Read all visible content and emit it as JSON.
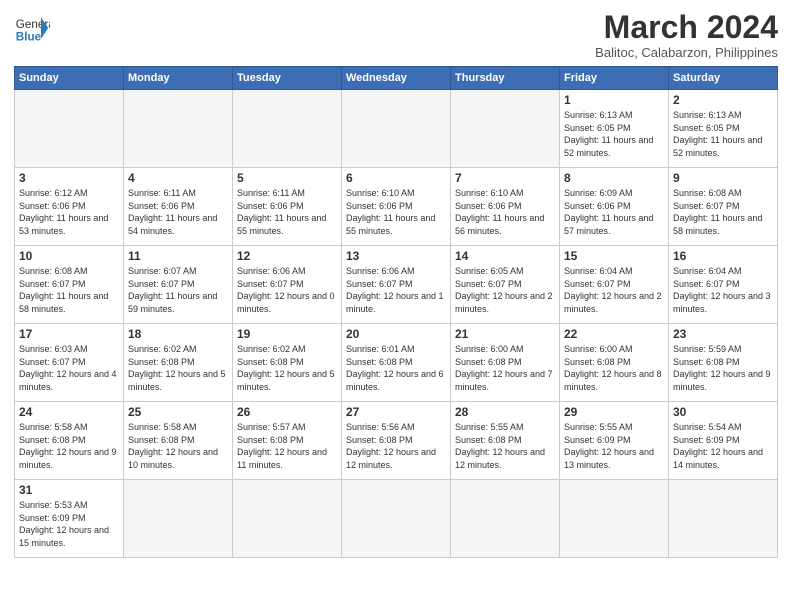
{
  "header": {
    "logo_general": "General",
    "logo_blue": "Blue",
    "month_title": "March 2024",
    "subtitle": "Balitoc, Calabarzon, Philippines"
  },
  "weekdays": [
    "Sunday",
    "Monday",
    "Tuesday",
    "Wednesday",
    "Thursday",
    "Friday",
    "Saturday"
  ],
  "weeks": [
    [
      {
        "day": "",
        "info": ""
      },
      {
        "day": "",
        "info": ""
      },
      {
        "day": "",
        "info": ""
      },
      {
        "day": "",
        "info": ""
      },
      {
        "day": "",
        "info": ""
      },
      {
        "day": "1",
        "info": "Sunrise: 6:13 AM\nSunset: 6:05 PM\nDaylight: 11 hours\nand 52 minutes."
      },
      {
        "day": "2",
        "info": "Sunrise: 6:13 AM\nSunset: 6:05 PM\nDaylight: 11 hours\nand 52 minutes."
      }
    ],
    [
      {
        "day": "3",
        "info": "Sunrise: 6:12 AM\nSunset: 6:06 PM\nDaylight: 11 hours\nand 53 minutes."
      },
      {
        "day": "4",
        "info": "Sunrise: 6:11 AM\nSunset: 6:06 PM\nDaylight: 11 hours\nand 54 minutes."
      },
      {
        "day": "5",
        "info": "Sunrise: 6:11 AM\nSunset: 6:06 PM\nDaylight: 11 hours\nand 55 minutes."
      },
      {
        "day": "6",
        "info": "Sunrise: 6:10 AM\nSunset: 6:06 PM\nDaylight: 11 hours\nand 55 minutes."
      },
      {
        "day": "7",
        "info": "Sunrise: 6:10 AM\nSunset: 6:06 PM\nDaylight: 11 hours\nand 56 minutes."
      },
      {
        "day": "8",
        "info": "Sunrise: 6:09 AM\nSunset: 6:06 PM\nDaylight: 11 hours\nand 57 minutes."
      },
      {
        "day": "9",
        "info": "Sunrise: 6:08 AM\nSunset: 6:07 PM\nDaylight: 11 hours\nand 58 minutes."
      }
    ],
    [
      {
        "day": "10",
        "info": "Sunrise: 6:08 AM\nSunset: 6:07 PM\nDaylight: 11 hours\nand 58 minutes."
      },
      {
        "day": "11",
        "info": "Sunrise: 6:07 AM\nSunset: 6:07 PM\nDaylight: 11 hours\nand 59 minutes."
      },
      {
        "day": "12",
        "info": "Sunrise: 6:06 AM\nSunset: 6:07 PM\nDaylight: 12 hours\nand 0 minutes."
      },
      {
        "day": "13",
        "info": "Sunrise: 6:06 AM\nSunset: 6:07 PM\nDaylight: 12 hours\nand 1 minute."
      },
      {
        "day": "14",
        "info": "Sunrise: 6:05 AM\nSunset: 6:07 PM\nDaylight: 12 hours\nand 2 minutes."
      },
      {
        "day": "15",
        "info": "Sunrise: 6:04 AM\nSunset: 6:07 PM\nDaylight: 12 hours\nand 2 minutes."
      },
      {
        "day": "16",
        "info": "Sunrise: 6:04 AM\nSunset: 6:07 PM\nDaylight: 12 hours\nand 3 minutes."
      }
    ],
    [
      {
        "day": "17",
        "info": "Sunrise: 6:03 AM\nSunset: 6:07 PM\nDaylight: 12 hours\nand 4 minutes."
      },
      {
        "day": "18",
        "info": "Sunrise: 6:02 AM\nSunset: 6:08 PM\nDaylight: 12 hours\nand 5 minutes."
      },
      {
        "day": "19",
        "info": "Sunrise: 6:02 AM\nSunset: 6:08 PM\nDaylight: 12 hours\nand 5 minutes."
      },
      {
        "day": "20",
        "info": "Sunrise: 6:01 AM\nSunset: 6:08 PM\nDaylight: 12 hours\nand 6 minutes."
      },
      {
        "day": "21",
        "info": "Sunrise: 6:00 AM\nSunset: 6:08 PM\nDaylight: 12 hours\nand 7 minutes."
      },
      {
        "day": "22",
        "info": "Sunrise: 6:00 AM\nSunset: 6:08 PM\nDaylight: 12 hours\nand 8 minutes."
      },
      {
        "day": "23",
        "info": "Sunrise: 5:59 AM\nSunset: 6:08 PM\nDaylight: 12 hours\nand 9 minutes."
      }
    ],
    [
      {
        "day": "24",
        "info": "Sunrise: 5:58 AM\nSunset: 6:08 PM\nDaylight: 12 hours\nand 9 minutes."
      },
      {
        "day": "25",
        "info": "Sunrise: 5:58 AM\nSunset: 6:08 PM\nDaylight: 12 hours\nand 10 minutes."
      },
      {
        "day": "26",
        "info": "Sunrise: 5:57 AM\nSunset: 6:08 PM\nDaylight: 12 hours\nand 11 minutes."
      },
      {
        "day": "27",
        "info": "Sunrise: 5:56 AM\nSunset: 6:08 PM\nDaylight: 12 hours\nand 12 minutes."
      },
      {
        "day": "28",
        "info": "Sunrise: 5:55 AM\nSunset: 6:08 PM\nDaylight: 12 hours\nand 12 minutes."
      },
      {
        "day": "29",
        "info": "Sunrise: 5:55 AM\nSunset: 6:09 PM\nDaylight: 12 hours\nand 13 minutes."
      },
      {
        "day": "30",
        "info": "Sunrise: 5:54 AM\nSunset: 6:09 PM\nDaylight: 12 hours\nand 14 minutes."
      }
    ],
    [
      {
        "day": "31",
        "info": "Sunrise: 5:53 AM\nSunset: 6:09 PM\nDaylight: 12 hours\nand 15 minutes."
      },
      {
        "day": "",
        "info": ""
      },
      {
        "day": "",
        "info": ""
      },
      {
        "day": "",
        "info": ""
      },
      {
        "day": "",
        "info": ""
      },
      {
        "day": "",
        "info": ""
      },
      {
        "day": "",
        "info": ""
      }
    ]
  ]
}
